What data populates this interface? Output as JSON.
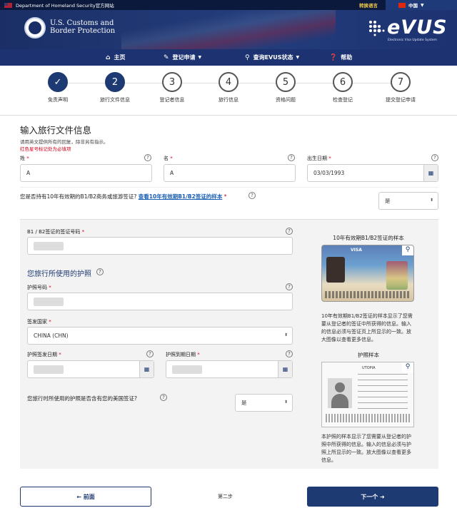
{
  "gov_bar": {
    "agency": "Department of Homeland Security官方网站",
    "switch_lang": "转换语言",
    "language": "中国"
  },
  "header": {
    "cbp_line1": "U.S. Customs and",
    "cbp_line2": "Border Protection",
    "logo_word": "eVUS",
    "logo_sub": "Electronic Visa Update System"
  },
  "nav": [
    {
      "icon": "home-icon",
      "label": "主页"
    },
    {
      "icon": "edit-icon",
      "label": "登记申请"
    },
    {
      "icon": "search-icon",
      "label": "查询EVUS状态"
    },
    {
      "icon": "help-icon",
      "label": "帮助"
    }
  ],
  "steps": [
    {
      "num": "✓",
      "label": "免责声明",
      "state": "done"
    },
    {
      "num": "2",
      "label": "旅行文件信息",
      "state": "active"
    },
    {
      "num": "3",
      "label": "登记者信息",
      "state": "todo"
    },
    {
      "num": "4",
      "label": "旅行信息",
      "state": "todo"
    },
    {
      "num": "5",
      "label": "资格问题",
      "state": "todo"
    },
    {
      "num": "6",
      "label": "检查登记",
      "state": "todo"
    },
    {
      "num": "7",
      "label": "提交登记申请",
      "state": "todo"
    }
  ],
  "form": {
    "title": "输入旅行文件信息",
    "note_english": "请用英文提供所有的回复，除非另有指示。",
    "note_required": "红色星号标记处为必填项",
    "surname_label": "姓",
    "surname_value": "A",
    "given_label": "名",
    "given_value": "A",
    "dob_label": "出生日期",
    "dob_value": "03/03/1993",
    "visa_question": "您是否持有10年有效期的B1/B2商务或旅游签证?",
    "visa_sample_link": "查看10年有效期B1/B2签证的样本",
    "visa_answer": "是",
    "visa_number_label": "B1 / B2签证的签证号码",
    "passport_section": "您旅行所使用的护照",
    "passport_number_label": "护照号码",
    "issuing_country_label": "签发国家",
    "issuing_country_value": "CHINA (CHN)",
    "issue_date_label": "护照签发日期",
    "expiry_date_label": "护照到期日期",
    "contains_visa_question": "您旅行时所使用的护照是否含有您的美国签证?",
    "contains_visa_answer": "是",
    "required_mark": "*",
    "help_mark": "?"
  },
  "sidebar": {
    "visa_sample_title": "10年有效期B1/B2签证的样本",
    "visa_caption": "VISA",
    "visa_desc": "10年有效期B1/B2签证的样本显示了您需要从登记者的签证中所获得的信息。输入的信息必须与签证页上所显示的一致。放大图像以查看更多信息。",
    "passport_sample_title": "护照样本",
    "passport_country": "UTOPIA",
    "passport_desc": "本护照的样本显示了您需要从登记者的护照中所获得的信息。输入的信息必须与护照上所显示的一致。放大图像以查看更多信息。"
  },
  "footer": {
    "prev_label": "← 前面",
    "step_text": "第二步",
    "next_label": "下一个 ➜"
  }
}
